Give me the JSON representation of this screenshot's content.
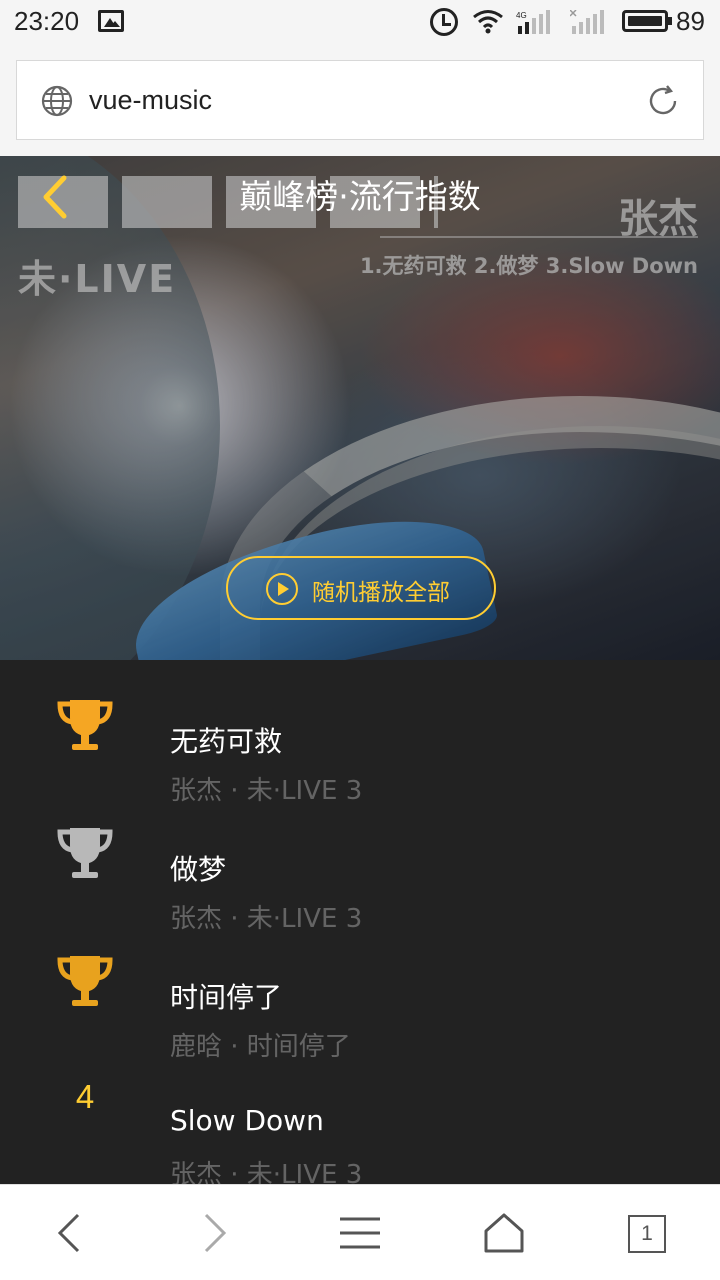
{
  "status_bar": {
    "time": "23:20",
    "battery": "89",
    "network_label": "4G"
  },
  "browser": {
    "url": "vue-music",
    "tab_count": "1"
  },
  "header": {
    "title": "巅峰榜·流行指数"
  },
  "banner": {
    "album_subtitle": "未·LIVE",
    "album_artist": "张杰",
    "album_tracks": "1.无药可救 2.做梦 3.Slow Down"
  },
  "play_all": {
    "label": "随机播放全部"
  },
  "songs": [
    {
      "rank": "1",
      "rank_icon": "trophy-gold-icon",
      "name": "无药可救",
      "desc": "张杰 · 未·LIVE 3"
    },
    {
      "rank": "2",
      "rank_icon": "trophy-silver-icon",
      "name": "做梦",
      "desc": "张杰 · 未·LIVE 3"
    },
    {
      "rank": "3",
      "rank_icon": "trophy-bronze-icon",
      "name": "时间停了",
      "desc": "鹿晗 · 时间停了"
    },
    {
      "rank": "4",
      "rank_icon": "",
      "name": "Slow Down",
      "desc": "张杰 · 未·LIVE 3"
    }
  ],
  "colors": {
    "accent": "#ffcd32",
    "list_bg": "#222222",
    "gold": "#f5a623",
    "silver": "#b8b8b8"
  }
}
